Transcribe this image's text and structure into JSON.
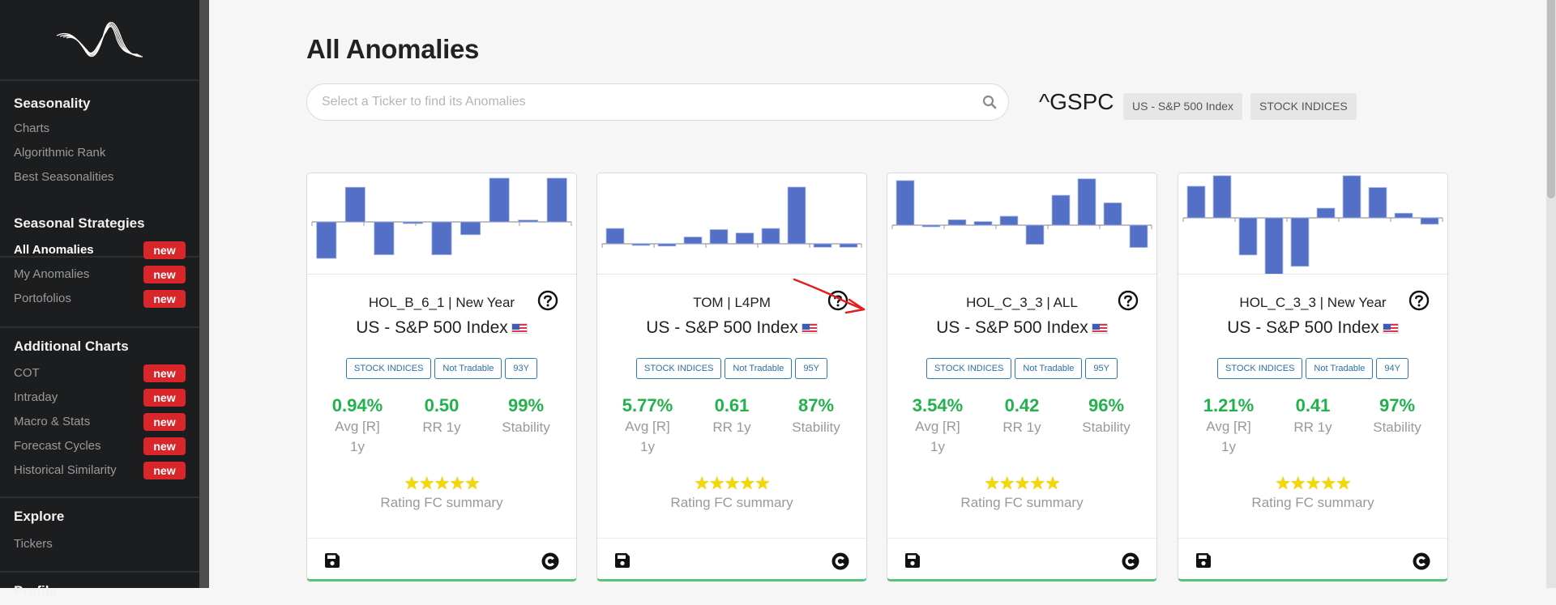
{
  "sidebar": {
    "logo": "wave-logo",
    "sections": [
      {
        "title": "Seasonality",
        "items": [
          {
            "label": "Charts",
            "new": false
          },
          {
            "label": "Algorithmic Rank",
            "new": false
          },
          {
            "label": "Best Seasonalities",
            "new": false
          }
        ]
      },
      {
        "title": "Seasonal Strategies",
        "items": [
          {
            "label": "All Anomalies",
            "new": true,
            "active": true
          },
          {
            "label": "My Anomalies",
            "new": true
          },
          {
            "label": "Portofolios",
            "new": true
          }
        ]
      },
      {
        "title": "Additional Charts",
        "items": [
          {
            "label": "COT",
            "new": true
          },
          {
            "label": "Intraday",
            "new": true
          },
          {
            "label": "Macro & Stats",
            "new": true
          },
          {
            "label": "Forecast Cycles",
            "new": true
          },
          {
            "label": "Historical Similarity",
            "new": true
          }
        ]
      },
      {
        "title": "Explore",
        "items": [
          {
            "label": "Tickers",
            "new": false
          }
        ]
      },
      {
        "title": "Profile",
        "items": []
      }
    ],
    "new_badge": "new"
  },
  "header": {
    "title": "All Anomalies",
    "search_placeholder": "Select a Ticker to find its Anomalies",
    "search_value": "",
    "ticker": "^GSPC",
    "tags": [
      "US - S&P 500 Index",
      "STOCK INDICES"
    ]
  },
  "colors": {
    "bar": "#5470c6",
    "positive": "#22b24c",
    "badge": "#d9262b",
    "pill": "#2a7ab8"
  },
  "cards": [
    {
      "name": "HOL_B_6_1 | New Year",
      "asset": "US - S&P 500 Index",
      "pills": [
        "STOCK INDICES",
        "Not Tradable",
        "93Y"
      ],
      "stats": [
        {
          "value": "0.94%",
          "label": "Avg [R] 1y"
        },
        {
          "value": "0.50",
          "label": "RR 1y"
        },
        {
          "value": "99%",
          "label": "Stability"
        }
      ],
      "rating": 5,
      "stars": "★★★★★",
      "rating_label": "Rating FC summary",
      "bars": [
        -1.0,
        0.95,
        -0.9,
        -0.03,
        -0.9,
        -0.35,
        1.2,
        0.05,
        1.2
      ]
    },
    {
      "name": "TOM | L4PM",
      "asset": "US - S&P 500 Index",
      "pills": [
        "STOCK INDICES",
        "Not Tradable",
        "95Y"
      ],
      "stats": [
        {
          "value": "5.77%",
          "label": "Avg [R] 1y"
        },
        {
          "value": "0.61",
          "label": "RR 1y"
        },
        {
          "value": "87%",
          "label": "Stability"
        }
      ],
      "rating": 5,
      "stars": "★★★★★",
      "rating_label": "Rating FC summary",
      "bars": [
        0.27,
        -0.02,
        -0.04,
        0.12,
        0.25,
        0.19,
        0.27,
        1.0,
        -0.06,
        -0.06
      ]
    },
    {
      "name": "HOL_C_3_3 | ALL",
      "asset": "US - S&P 500 Index",
      "pills": [
        "STOCK INDICES",
        "Not Tradable",
        "95Y"
      ],
      "stats": [
        {
          "value": "3.54%",
          "label": "Avg [R] 1y"
        },
        {
          "value": "0.42",
          "label": "RR 1y"
        },
        {
          "value": "96%",
          "label": "Stability"
        }
      ],
      "rating": 5,
      "stars": "★★★★★",
      "rating_label": "Rating FC summary",
      "bars": [
        1.0,
        -0.03,
        0.12,
        0.08,
        0.2,
        -0.43,
        0.67,
        1.04,
        0.5,
        -0.5
      ]
    },
    {
      "name": "HOL_C_3_3 | New Year",
      "asset": "US - S&P 500 Index",
      "pills": [
        "STOCK INDICES",
        "Not Tradable",
        "94Y"
      ],
      "stats": [
        {
          "value": "1.21%",
          "label": "Avg [R] 1y"
        },
        {
          "value": "0.41",
          "label": "RR 1y"
        },
        {
          "value": "97%",
          "label": "Stability"
        }
      ],
      "rating": 5,
      "stars": "★★★★★",
      "rating_label": "Rating FC summary",
      "bars": [
        0.75,
        1.0,
        -0.88,
        -1.38,
        -1.15,
        0.23,
        1.0,
        0.72,
        0.11,
        -0.15
      ]
    }
  ]
}
